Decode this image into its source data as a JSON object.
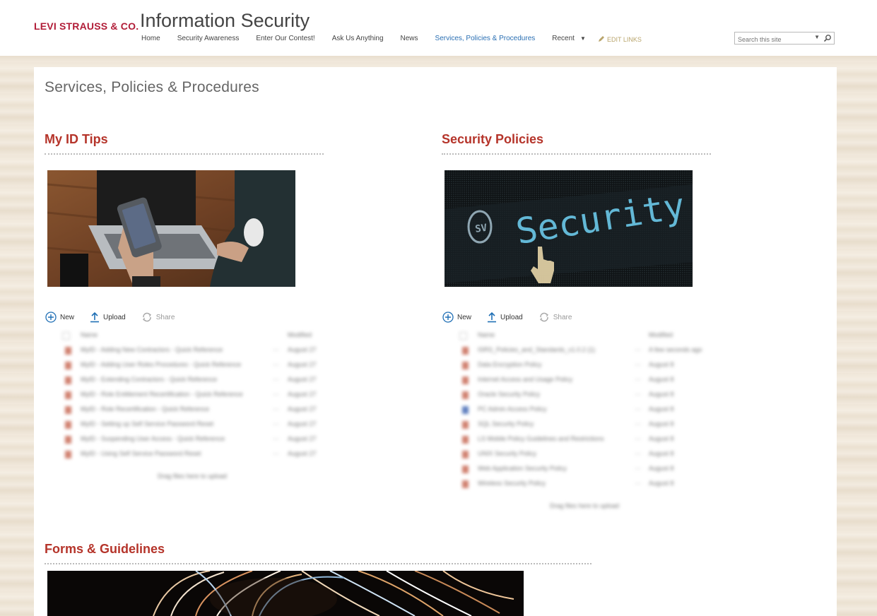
{
  "header": {
    "logo_text": "LEVI STRAUSS & CO.",
    "site_title": "Information Security",
    "nav": [
      {
        "label": "Home"
      },
      {
        "label": "Security Awareness"
      },
      {
        "label": "Enter Our Contest!"
      },
      {
        "label": "Ask Us Anything"
      },
      {
        "label": "News"
      },
      {
        "label": "Services, Policies & Procedures",
        "active": true
      },
      {
        "label": "Recent"
      }
    ],
    "edit_links": "EDIT LINKS",
    "search_placeholder": "Search this site"
  },
  "page": {
    "title": "Services, Policies & Procedures"
  },
  "sections": {
    "id_tips": {
      "heading": "My ID Tips",
      "toolbar": {
        "new": "New",
        "upload": "Upload",
        "share": "Share"
      },
      "columns": {
        "name": "Name",
        "modified": "Modified"
      },
      "files": [
        {
          "name": "MyID - Adding New Contractors - Quick Reference",
          "modified": "August 27"
        },
        {
          "name": "MyID - Adding User Roles Procedures - Quick Reference",
          "modified": "August 27"
        },
        {
          "name": "MyID - Extending Contractors - Quick Reference",
          "modified": "August 27"
        },
        {
          "name": "MyID - Role Entitlement Recertification - Quick Reference",
          "modified": "August 27"
        },
        {
          "name": "MyID - Role Recertification - Quick Reference",
          "modified": "August 27"
        },
        {
          "name": "MyID - Setting up Self Service Password Reset",
          "modified": "August 27"
        },
        {
          "name": "MyID - Suspending User Access - Quick Reference",
          "modified": "August 27"
        },
        {
          "name": "MyID - Using Self Service Password Reset",
          "modified": "August 27"
        }
      ],
      "drag_note": "Drag files here to upload"
    },
    "security_policies": {
      "heading": "Security Policies",
      "image_text": "Security",
      "toolbar": {
        "new": "New",
        "upload": "Upload",
        "share": "Share"
      },
      "columns": {
        "name": "Name",
        "modified": "Modified"
      },
      "files": [
        {
          "name": "ISRS_Policies_and_Standards_v1.0.2 (1)",
          "modified": "A few seconds ago"
        },
        {
          "name": "Data Encryption Policy",
          "modified": "August 8"
        },
        {
          "name": "Internet Access and Usage Policy",
          "modified": "August 8"
        },
        {
          "name": "Oracle Security Policy",
          "modified": "August 8"
        },
        {
          "name": "PC Admin Access Policy",
          "modified": "August 8"
        },
        {
          "name": "SQL Security Policy",
          "modified": "August 8"
        },
        {
          "name": "LS Mobile Policy Guidelines and Restrictions",
          "modified": "August 8"
        },
        {
          "name": "UNIX Security Policy",
          "modified": "August 8"
        },
        {
          "name": "Web Application Security Policy",
          "modified": "August 8"
        },
        {
          "name": "Wireless Security Policy",
          "modified": "August 8"
        }
      ],
      "drag_note": "Drag files here to upload"
    },
    "forms": {
      "heading": "Forms & Guidelines"
    }
  },
  "colors": {
    "brand": "#b11c37",
    "heading": "#b5342a",
    "active_nav": "#2a6fb3",
    "action_icon": "#1f6fb5"
  },
  "icons": [
    "search-icon",
    "chevron-down-icon",
    "pencil-icon",
    "plus-circle-icon",
    "upload-icon",
    "share-icon",
    "document-icon"
  ]
}
